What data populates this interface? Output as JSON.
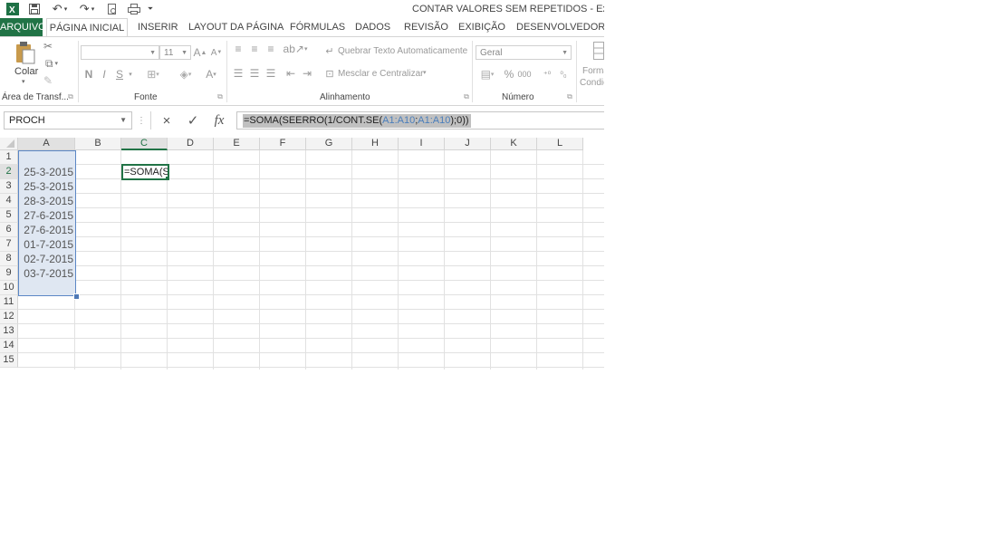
{
  "window": {
    "title": "CONTAR VALORES SEM REPETIDOS - Excel",
    "excel_icon": "excel-icon",
    "qat": [
      "save-icon",
      "undo-icon",
      "redo-icon",
      "print-preview-icon",
      "quick-print-icon"
    ]
  },
  "tabs": [
    {
      "label": "ARQUIVO"
    },
    {
      "label": "PÁGINA INICIAL"
    },
    {
      "label": "INSERIR"
    },
    {
      "label": "LAYOUT DA PÁGINA"
    },
    {
      "label": "FÓRMULAS"
    },
    {
      "label": "DADOS"
    },
    {
      "label": "REVISÃO"
    },
    {
      "label": "EXIBIÇÃO"
    },
    {
      "label": "DESENVOLVEDOR"
    }
  ],
  "ribbon": {
    "clipboard": {
      "paste_label": "Colar",
      "group_label": "Área de Transf..."
    },
    "font": {
      "font_name": "",
      "font_size": "11",
      "bold": "N",
      "italic": "I",
      "underline": "S",
      "group_label": "Fonte"
    },
    "alignment": {
      "wrap_text": "Quebrar Texto Automaticamente",
      "merge_center": "Mesclar e Centralizar",
      "group_label": "Alinhamento"
    },
    "number": {
      "format": "Geral",
      "percent": "%",
      "thousands": "000",
      "group_label": "Número"
    },
    "styles": {
      "label_line1": "Forma",
      "label_line2": "Condic"
    }
  },
  "formula_bar": {
    "name_box": "PROCH",
    "cancel_icon": "×",
    "enter_icon": "✓",
    "fx_label": "fx",
    "formula_parts": [
      "=SOMA(SEERRO(1/CONT.SE(",
      "A1:A10",
      ";",
      "A1:A10",
      ");0))"
    ]
  },
  "sheet": {
    "columns": [
      "A",
      "B",
      "C",
      "D",
      "E",
      "F",
      "G",
      "H",
      "I",
      "J",
      "K",
      "L"
    ],
    "rows": [
      "1",
      "2",
      "3",
      "4",
      "5",
      "6",
      "7",
      "8",
      "9",
      "10",
      "11",
      "12",
      "13",
      "14",
      "15"
    ],
    "selected_column": "C",
    "selected_row": "2",
    "column_a_values": [
      "25-3-2015",
      "25-3-2015",
      "28-3-2015",
      "27-6-2015",
      "27-6-2015",
      "01-7-2015",
      "02-7-2015",
      "03-7-2015"
    ],
    "active_cell_text": "=SOMA(SE"
  }
}
